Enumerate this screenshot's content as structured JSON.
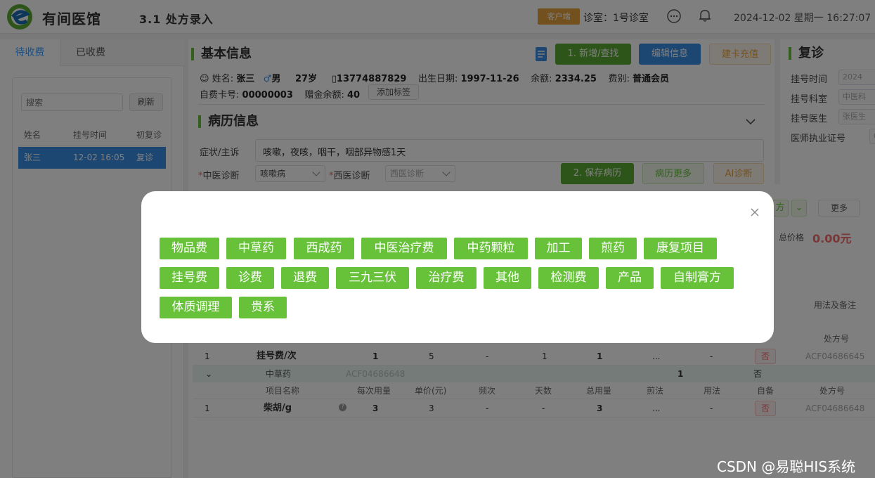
{
  "header": {
    "app_title": "有间医馆",
    "page_title": "3.1 处方录入",
    "client_badge": "客户端",
    "clinic_room": "诊室：1号诊室",
    "datetime": "2024-12-02 星期一 16:27:07"
  },
  "left": {
    "tabs": [
      "待收费",
      "已收费"
    ],
    "search_placeholder": "搜索",
    "refresh": "刷新",
    "columns": [
      "姓名",
      "挂号时间",
      "初复诊"
    ],
    "rows": [
      [
        "张三",
        "12-02 16:05",
        "复诊"
      ]
    ]
  },
  "basic": {
    "title": "基本信息",
    "btn_new": "1. 新增/查找",
    "btn_edit": "编辑信息",
    "btn_card": "建卡充值",
    "name_label": "姓名:",
    "name": "张三",
    "gender": "男",
    "age": "27岁",
    "phone": "13774887829",
    "birth_label": "出生日期:",
    "birth": "1997-11-26",
    "balance_label": "余额:",
    "balance": "2334.25",
    "fee_type_label": "费别:",
    "fee_type": "普通会员",
    "card_label": "自费卡号:",
    "card_no": "00000003",
    "gift_label": "赠金余额:",
    "gift": "40",
    "add_tag": "添加标签"
  },
  "record": {
    "title": "病历信息",
    "symptom_label": "症状/主诉",
    "symptom": "咳嗽，夜咳，咽干，咽部异物感1天",
    "tcm_label": "中医诊断",
    "tcm_value": "咳嗽病",
    "western_label": "西医诊断",
    "western_placeholder": "西医诊断",
    "btn_save": "2. 保存病历",
    "btn_more": "病历更多",
    "btn_ai": "AI诊断"
  },
  "right": {
    "title": "复诊",
    "fields": [
      {
        "label": "挂号时间",
        "value": "2024"
      },
      {
        "label": "挂号科室",
        "value": "中医科"
      },
      {
        "label": "挂号医生",
        "value": "张医生"
      },
      {
        "label": "医师执业证号",
        "value": "0"
      }
    ]
  },
  "lower": {
    "btn_fang": "方",
    "btn_more": "更多",
    "total_label": "总价格",
    "total_value": "0.00元",
    "usage_header": "用法及备注",
    "rx_header": "处方号",
    "row1": {
      "idx": "1",
      "name": "挂号费/次",
      "per": "1",
      "price": "5",
      "freq": "-",
      "days": "1",
      "total": "1",
      "decoct": "...",
      "usage": "-",
      "self": "否",
      "rx": "ACF04686645"
    },
    "group": {
      "type": "中草药",
      "rx": "ACF04686648",
      "count": "1",
      "self": "否"
    },
    "columns": [
      "项目名称",
      "每次用量",
      "单价(元)",
      "频次",
      "天数",
      "总用量",
      "煎法",
      "用法",
      "自备",
      "处方号"
    ],
    "row2": {
      "idx": "1",
      "name": "柴胡/g",
      "per": "3",
      "price": "3",
      "freq": "-",
      "days": "-",
      "total": "3",
      "decoct": "...",
      "usage": "-",
      "self": "否",
      "rx": "ACF04686648"
    }
  },
  "modal": {
    "tags": [
      "物品费",
      "中草药",
      "西成药",
      "中医治疗费",
      "中药颗粒",
      "加工",
      "煎药",
      "康复项目",
      "挂号费",
      "诊费",
      "退费",
      "三九三伏",
      "治疗费",
      "其他",
      "检测费",
      "产品",
      "自制膏方",
      "体质调理",
      "贵系"
    ]
  },
  "watermark": "CSDN @易聪HIS系统",
  "colors": {
    "green": "#67c23a",
    "blue": "#3a8ee6",
    "red": "#f56c6c",
    "orange": "#e6a23c"
  }
}
